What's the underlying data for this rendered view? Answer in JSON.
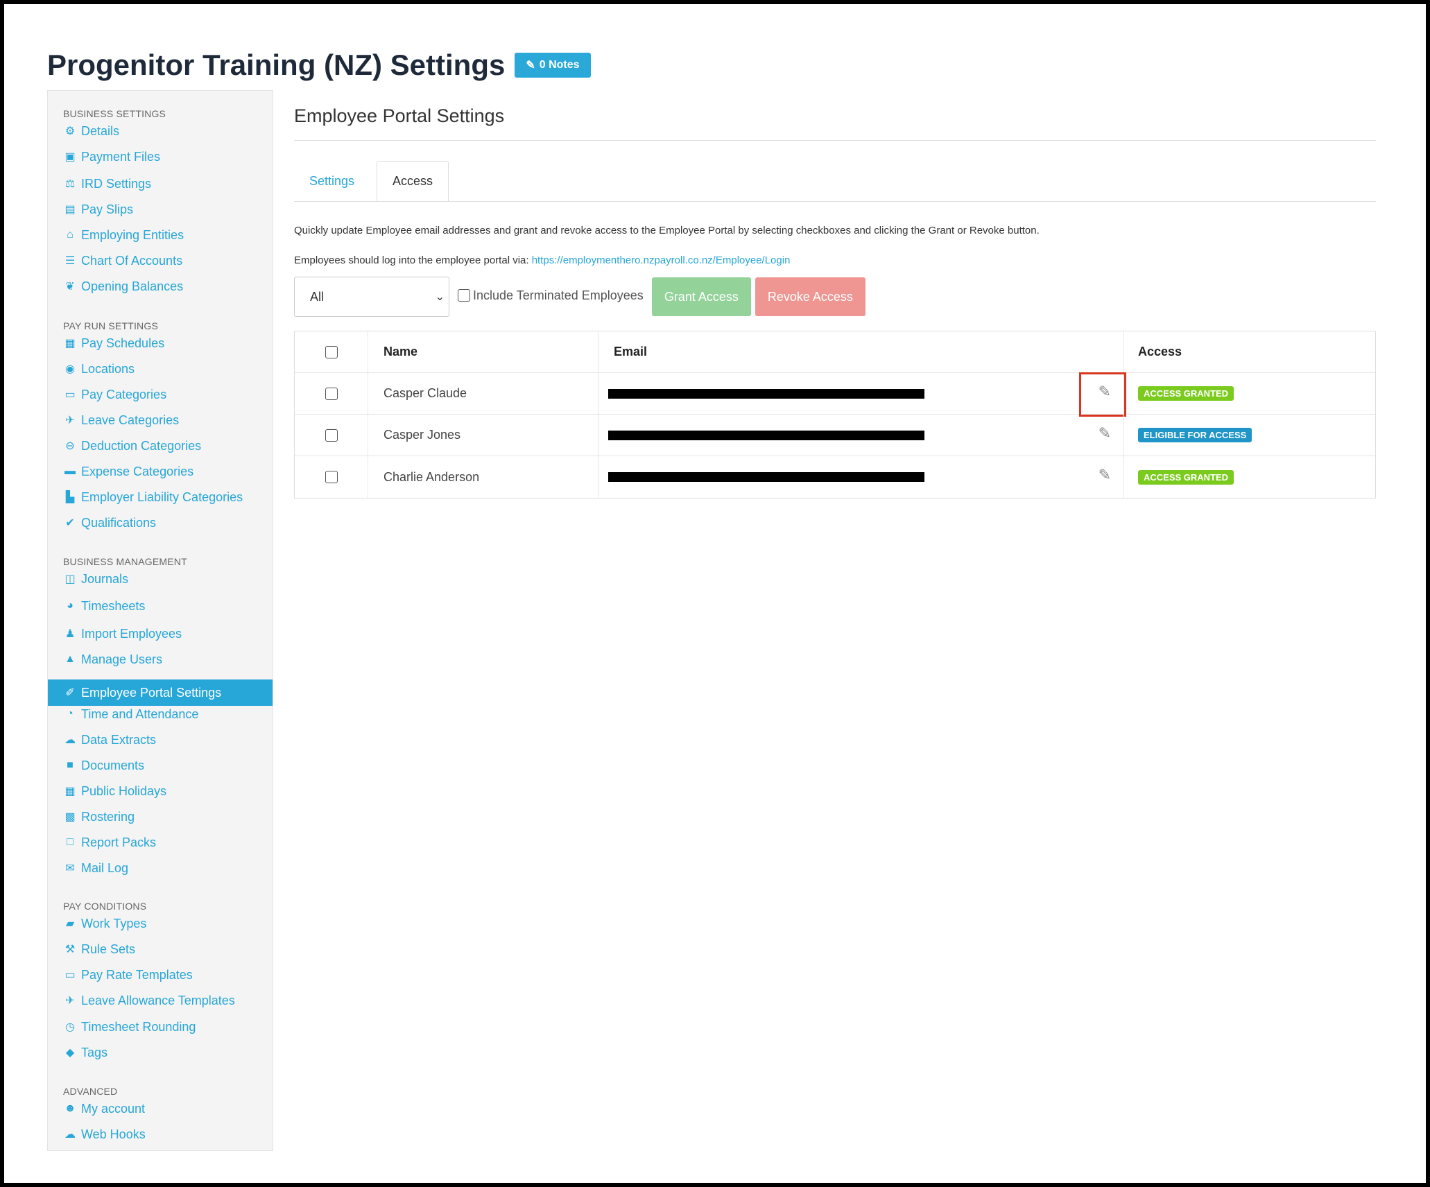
{
  "header": {
    "title": "Progenitor Training (NZ) Settings",
    "notes_label": "0 Notes"
  },
  "sidebar": {
    "sections": [
      {
        "heading": "BUSINESS SETTINGS",
        "items": [
          {
            "label": "Details",
            "icon": "gear-icon"
          },
          {
            "label": "Payment Files",
            "icon": "floppy-icon"
          },
          {
            "label": "IRD Settings",
            "icon": "scale-icon"
          },
          {
            "label": "Pay Slips",
            "icon": "file-icon"
          },
          {
            "label": "Employing Entities",
            "icon": "bank-icon"
          },
          {
            "label": "Chart Of Accounts",
            "icon": "list-icon"
          },
          {
            "label": "Opening Balances",
            "icon": "leaf-icon"
          }
        ]
      },
      {
        "heading": "PAY RUN SETTINGS",
        "items": [
          {
            "label": "Pay Schedules",
            "icon": "calendar-icon"
          },
          {
            "label": "Locations",
            "icon": "globe-icon"
          },
          {
            "label": "Pay Categories",
            "icon": "money-icon"
          },
          {
            "label": "Leave Categories",
            "icon": "plane-icon"
          },
          {
            "label": "Deduction Categories",
            "icon": "minus-circle-icon"
          },
          {
            "label": "Expense Categories",
            "icon": "archive-icon"
          },
          {
            "label": "Employer Liability Categories",
            "icon": "chart-icon"
          },
          {
            "label": "Qualifications",
            "icon": "check-icon"
          }
        ]
      },
      {
        "heading": "BUSINESS MANAGEMENT",
        "items": [
          {
            "label": "Journals",
            "icon": "columns-icon"
          },
          {
            "label": "Timesheets",
            "icon": "pie-icon"
          },
          {
            "label": "Import Employees",
            "icon": "people-icon"
          },
          {
            "label": "Manage Users",
            "icon": "lock-icon"
          },
          {
            "label": "Employee Portal Settings",
            "icon": "magic-wand-icon"
          },
          {
            "label": "Time and Attendance",
            "icon": "clock-user-icon"
          },
          {
            "label": "Data Extracts",
            "icon": "cloud-download-icon"
          },
          {
            "label": "Documents",
            "icon": "folder-icon"
          },
          {
            "label": "Public Holidays",
            "icon": "calendar-icon"
          },
          {
            "label": "Rostering",
            "icon": "calendar-grid-icon"
          },
          {
            "label": "Report Packs",
            "icon": "folder-open-icon"
          },
          {
            "label": "Mail Log",
            "icon": "envelope-icon"
          }
        ]
      },
      {
        "heading": "PAY CONDITIONS",
        "items": [
          {
            "label": "Work Types",
            "icon": "book-icon"
          },
          {
            "label": "Rule Sets",
            "icon": "gavel-icon"
          },
          {
            "label": "Pay Rate Templates",
            "icon": "money-icon"
          },
          {
            "label": "Leave Allowance Templates",
            "icon": "plane-icon"
          },
          {
            "label": "Timesheet Rounding",
            "icon": "clock-icon"
          },
          {
            "label": "Tags",
            "icon": "tag-icon"
          }
        ]
      },
      {
        "heading": "ADVANCED",
        "items": [
          {
            "label": "My account",
            "icon": "user-circle-icon"
          },
          {
            "label": "Web Hooks",
            "icon": "cloud-icon"
          }
        ]
      }
    ],
    "active": "Employee Portal Settings"
  },
  "main": {
    "title": "Employee Portal Settings",
    "tabs": [
      {
        "label": "Settings"
      },
      {
        "label": "Access"
      }
    ],
    "active_tab": "Access",
    "description": "Quickly update Employee email addresses and grant and revoke access to the Employee Portal by selecting checkboxes and clicking the Grant or Revoke button.",
    "login_prefix": "Employees should log into the employee portal via:",
    "login_url": "https://employmenthero.nzpayroll.co.nz/Employee/Login",
    "filter_value": "All",
    "include_terminated_label": "Include Terminated Employees",
    "grant_label": "Grant Access",
    "revoke_label": "Revoke Access",
    "table": {
      "headers": {
        "name": "Name",
        "email": "Email",
        "access": "Access"
      },
      "rows": [
        {
          "name": "Casper Claude",
          "access": "ACCESS GRANTED",
          "status": "granted"
        },
        {
          "name": "Casper Jones",
          "access": "ELIGIBLE FOR ACCESS",
          "status": "eligible"
        },
        {
          "name": "Charlie Anderson",
          "access": "ACCESS GRANTED",
          "status": "granted"
        }
      ]
    }
  },
  "colors": {
    "accent": "#27a6d8",
    "granted": "#7bcb1f",
    "eligible": "#1f96c7",
    "grant_btn": "#93d39a",
    "revoke_btn": "#ef9693",
    "highlight": "#d9361f"
  }
}
